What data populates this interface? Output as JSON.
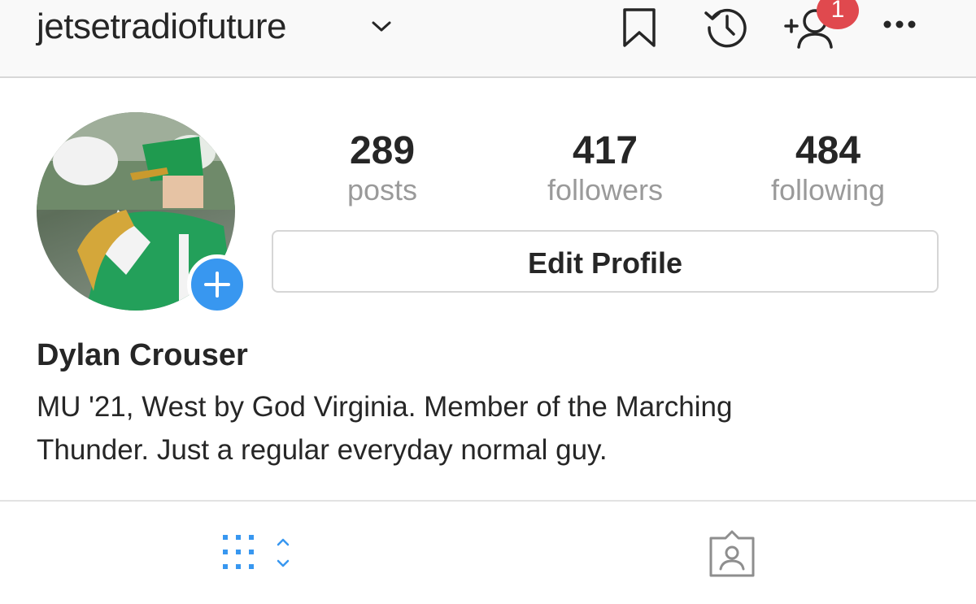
{
  "header": {
    "username": "jetsetradiofuture",
    "username_dropdown_icon": "chevron-down-icon",
    "icons": [
      "bookmark-icon",
      "history-icon",
      "add-person-icon",
      "more-icon"
    ],
    "notification_count": "1"
  },
  "profile": {
    "avatar_icon": "avatar",
    "add_story_icon": "plus-icon",
    "stats": {
      "posts": {
        "value": "289",
        "label": "posts"
      },
      "followers": {
        "value": "417",
        "label": "followers"
      },
      "following": {
        "value": "484",
        "label": "following"
      }
    },
    "edit_button": "Edit Profile",
    "name": "Dylan Crouser",
    "bio_line1": "MU '21, West by God Virginia. Member of the Marching",
    "bio_line2": "Thunder. Just a regular everyday normal guy."
  },
  "tabs": {
    "icons": [
      "grid-icon",
      "tagged-icon"
    ]
  },
  "colors": {
    "accent": "#3897f0",
    "badge": "#e0494e",
    "text": "#262626",
    "muted": "#9a9a9a"
  }
}
